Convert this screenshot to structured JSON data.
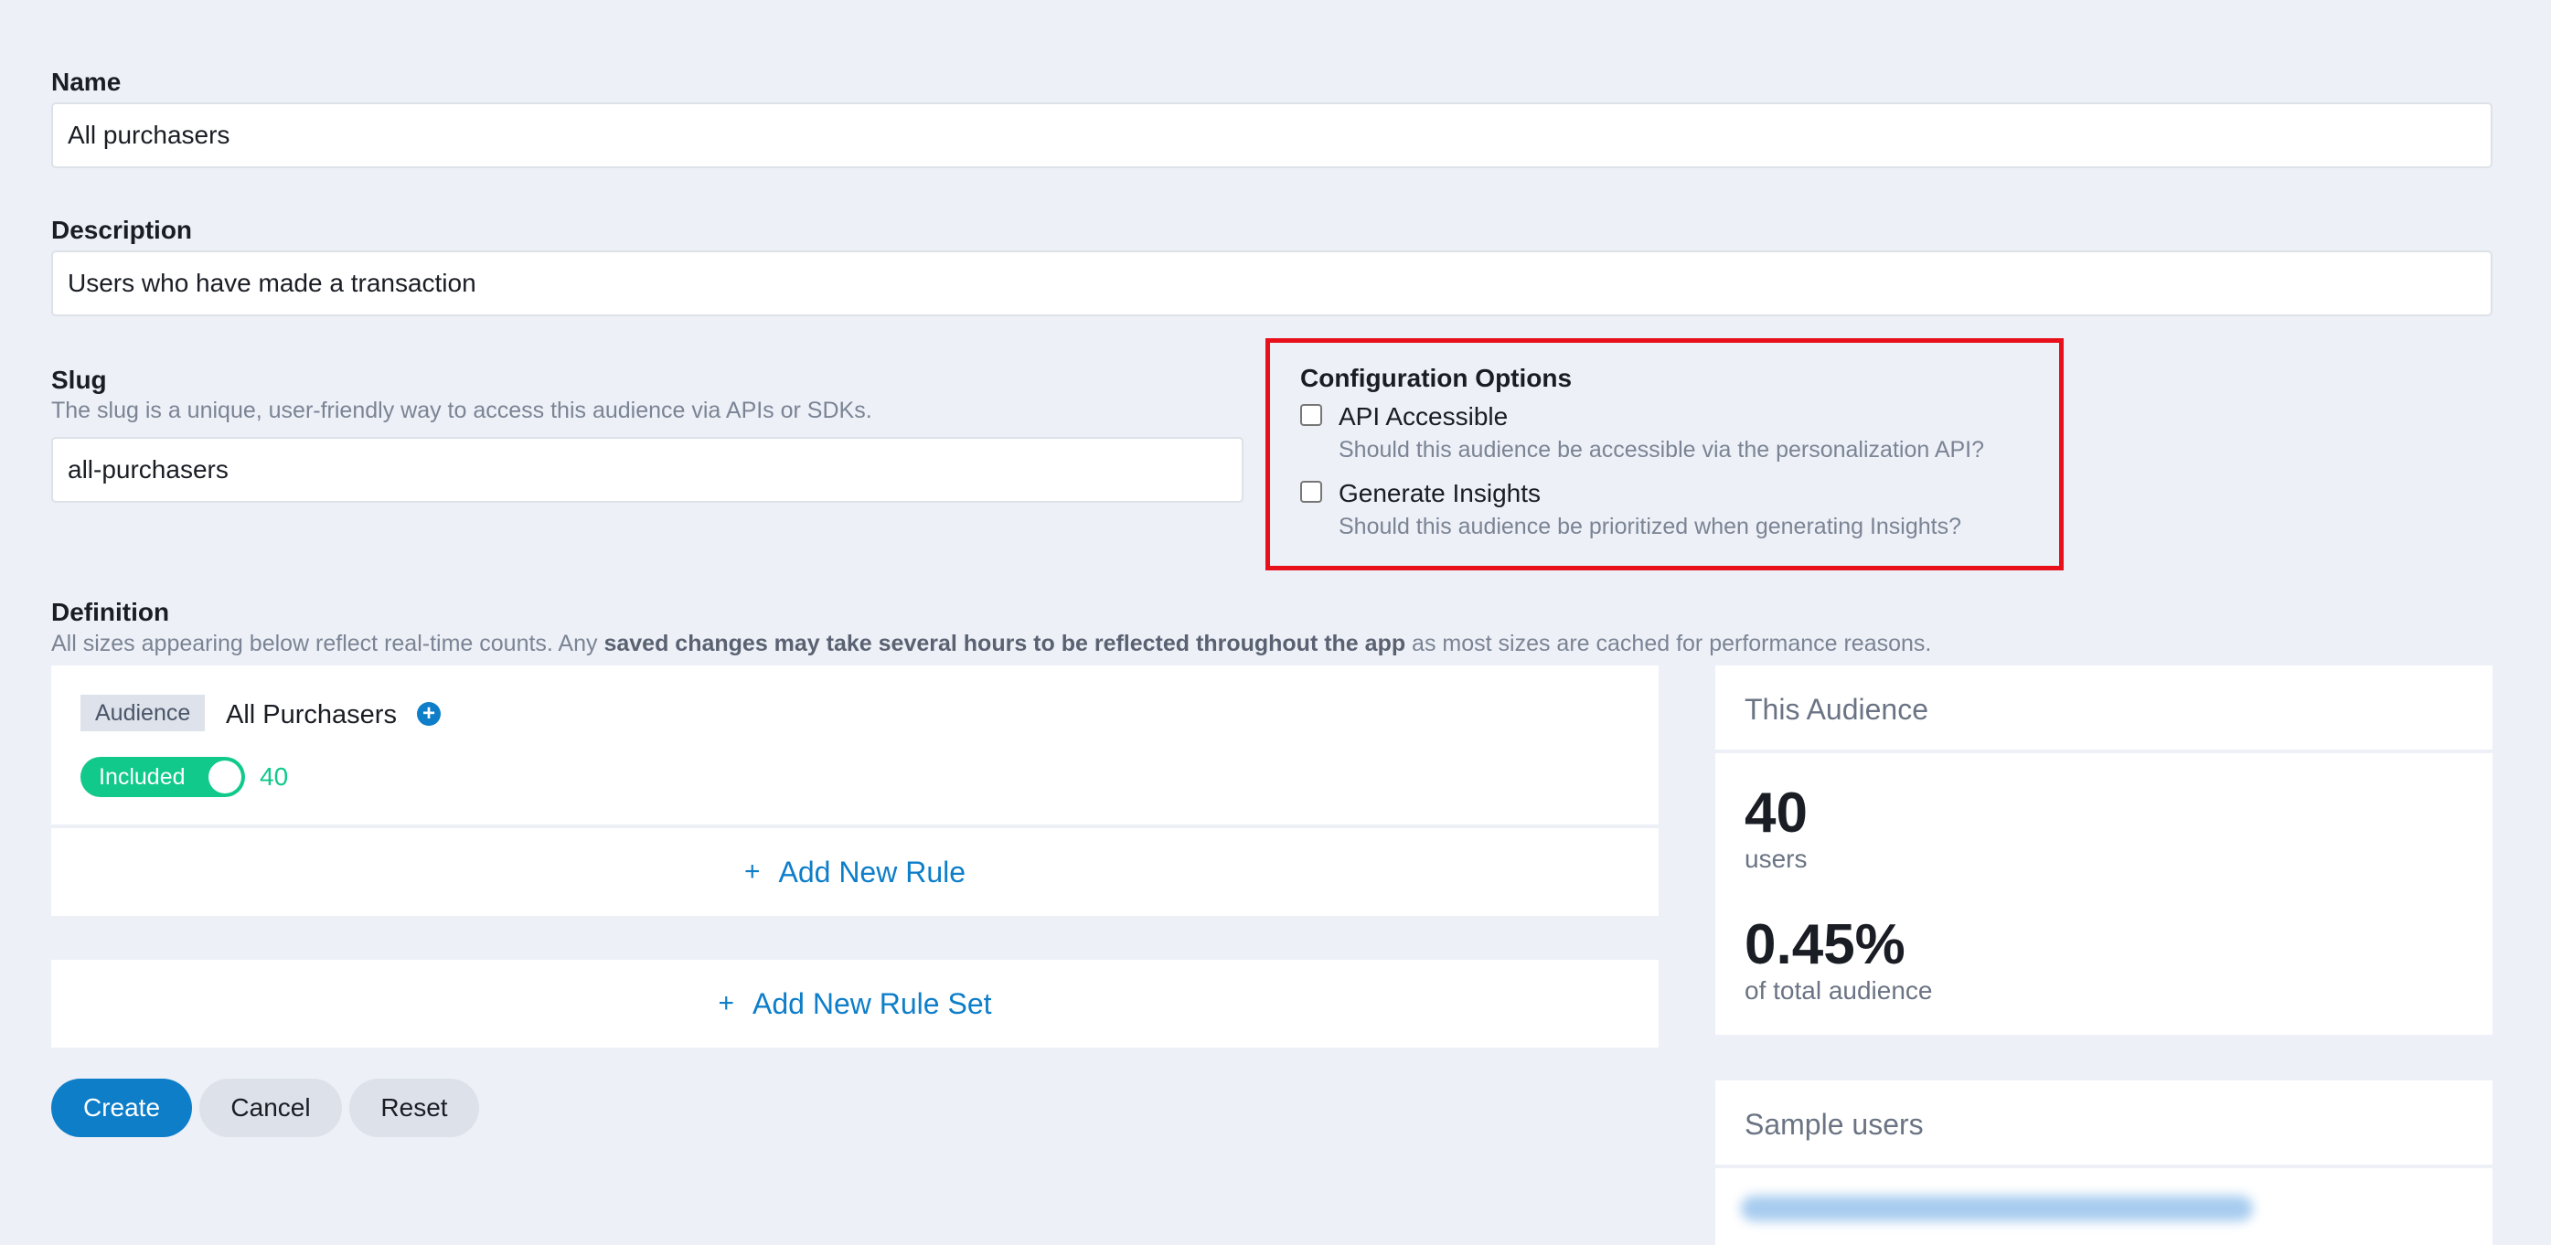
{
  "name": {
    "label": "Name",
    "value": "All purchasers"
  },
  "description": {
    "label": "Description",
    "value": "Users who have made a transaction"
  },
  "slug": {
    "label": "Slug",
    "hint": "The slug is a unique, user-friendly way to access this audience via APIs or SDKs.",
    "value": "all-purchasers"
  },
  "config": {
    "title": "Configuration Options",
    "options": [
      {
        "label": "API Accessible",
        "hint": "Should this audience be accessible via the personalization API?",
        "checked": false
      },
      {
        "label": "Generate Insights",
        "hint": "Should this audience be prioritized when generating Insights?",
        "checked": false
      }
    ]
  },
  "definition": {
    "label": "Definition",
    "hint_prefix": "All sizes appearing below reflect real-time counts. Any ",
    "hint_bold": "saved changes may take several hours to be reflected throughout the app",
    "hint_suffix": " as most sizes are cached for performance reasons.",
    "rule": {
      "tag": "Audience",
      "name": "All Purchasers",
      "toggle_label": "Included",
      "count": "40"
    },
    "add_rule": "Add New Rule",
    "add_rule_set": "Add New Rule Set",
    "plus": "+"
  },
  "buttons": {
    "create": "Create",
    "cancel": "Cancel",
    "reset": "Reset"
  },
  "stats": {
    "title": "This Audience",
    "users_value": "40",
    "users_label": "users",
    "pct_value": "0.45%",
    "pct_label": "of total audience"
  },
  "sample": {
    "title": "Sample users"
  },
  "colors": {
    "accent": "#0e7ec9",
    "highlight": "#e8101a",
    "success": "#10c98a",
    "background": "#edf0f7"
  }
}
